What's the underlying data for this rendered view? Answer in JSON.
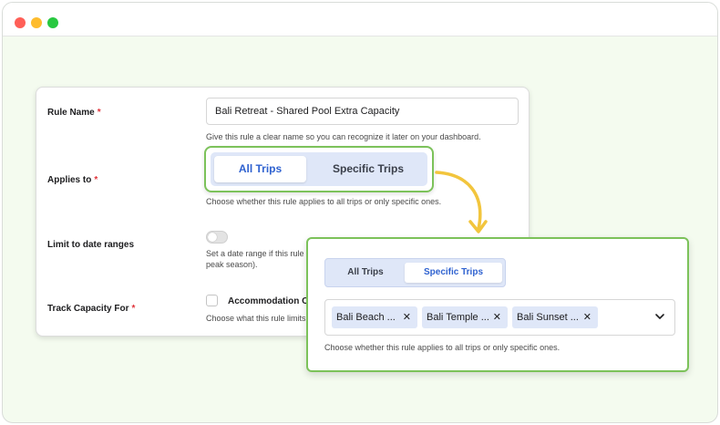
{
  "rule_form": {
    "rule_name": {
      "label": "Rule Name",
      "required_mark": "*",
      "value": "Bali Retreat - Shared Pool Extra Capacity",
      "help": "Give this rule a clear name so you can recognize it later on your dashboard."
    },
    "applies_to": {
      "label": "Applies to",
      "required_mark": "*",
      "options": [
        "All Trips",
        "Specific Trips"
      ],
      "selected": "All Trips",
      "help": "Choose whether this rule applies to all trips or only specific ones."
    },
    "date_ranges": {
      "label": "Limit to date ranges",
      "toggle_on": false,
      "help_line1": "Set a date range if this rule",
      "help_line2": "peak season)."
    },
    "track_capacity": {
      "label": "Track Capacity For",
      "required_mark": "*",
      "option_label": "Accommodation Op",
      "checked": false,
      "help": "Choose what this rule limits"
    }
  },
  "popup": {
    "options": [
      "All Trips",
      "Specific Trips"
    ],
    "selected": "Specific Trips",
    "selected_trips": [
      "Bali Beach ...",
      "Bali Temple ...",
      "Bali Sunset ..."
    ],
    "remove_glyph": "✕",
    "help": "Choose whether this rule applies to all trips or only specific ones."
  },
  "colors": {
    "accent_blue": "#2f62d0",
    "highlight_green": "#7cc25a",
    "arrow_yellow": "#f2c53d",
    "required_red": "#e0343b",
    "segment_bg": "#dfe7f8",
    "page_bg": "#f4fbef"
  },
  "icons": {
    "chip_remove": "close-icon",
    "dropdown": "chevron-down-icon",
    "callout": "curved-arrow-icon"
  }
}
